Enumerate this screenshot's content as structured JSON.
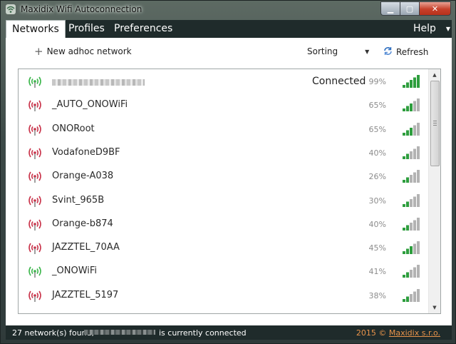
{
  "window": {
    "title": "Maxidix Wifi Autoconnection",
    "controls": {
      "minimize": "▁",
      "maximize": "▢",
      "close": "✕"
    }
  },
  "menubar": {
    "tabs": [
      {
        "label": "Networks",
        "active": true
      },
      {
        "label": "Profiles",
        "active": false
      },
      {
        "label": "Preferences",
        "active": false
      }
    ],
    "help": "Help",
    "help_caret": "▼"
  },
  "toolbar": {
    "new_adhoc": "New adhoc network",
    "sorting": "Sorting",
    "sorting_caret": "▼",
    "refresh": "Refresh"
  },
  "colors": {
    "signal_green": "#3ab54a",
    "signal_red": "#c9334a",
    "bar_green": "#2e9e3e",
    "bar_gray": "#b3b3b3",
    "accent_orange": "#e8934a"
  },
  "networks": [
    {
      "name": "",
      "status": "Connected",
      "signal": "99%",
      "level": 5,
      "icon": "wifi-connected-icon",
      "color": "green"
    },
    {
      "name": "_AUTO_ONOWiFi",
      "status": "",
      "signal": "65%",
      "level": 3,
      "icon": "wifi-icon",
      "color": "red"
    },
    {
      "name": "ONORoot",
      "status": "",
      "signal": "65%",
      "level": 3,
      "icon": "wifi-icon",
      "color": "red"
    },
    {
      "name": "VodafoneD9BF",
      "status": "",
      "signal": "40%",
      "level": 2,
      "icon": "wifi-icon",
      "color": "red"
    },
    {
      "name": "Orange-A038",
      "status": "",
      "signal": "26%",
      "level": 2,
      "icon": "wifi-icon",
      "color": "red"
    },
    {
      "name": "Svint_965B",
      "status": "",
      "signal": "30%",
      "level": 2,
      "icon": "wifi-icon",
      "color": "red"
    },
    {
      "name": "Orange-b874",
      "status": "",
      "signal": "40%",
      "level": 2,
      "icon": "wifi-icon",
      "color": "red"
    },
    {
      "name": "JAZZTEL_70AA",
      "status": "",
      "signal": "45%",
      "level": 3,
      "icon": "wifi-icon",
      "color": "red"
    },
    {
      "name": "_ONOWiFi",
      "status": "",
      "signal": "41%",
      "level": 2,
      "icon": "wifi-icon",
      "color": "green"
    },
    {
      "name": "JAZZTEL_5197",
      "status": "",
      "signal": "38%",
      "level": 2,
      "icon": "wifi-icon",
      "color": "red"
    }
  ],
  "statusbar": {
    "found": "27 network(s) found,",
    "connected_suffix": "is currently connected",
    "year": "2015 ©",
    "company": "Maxidix s.r.o."
  }
}
